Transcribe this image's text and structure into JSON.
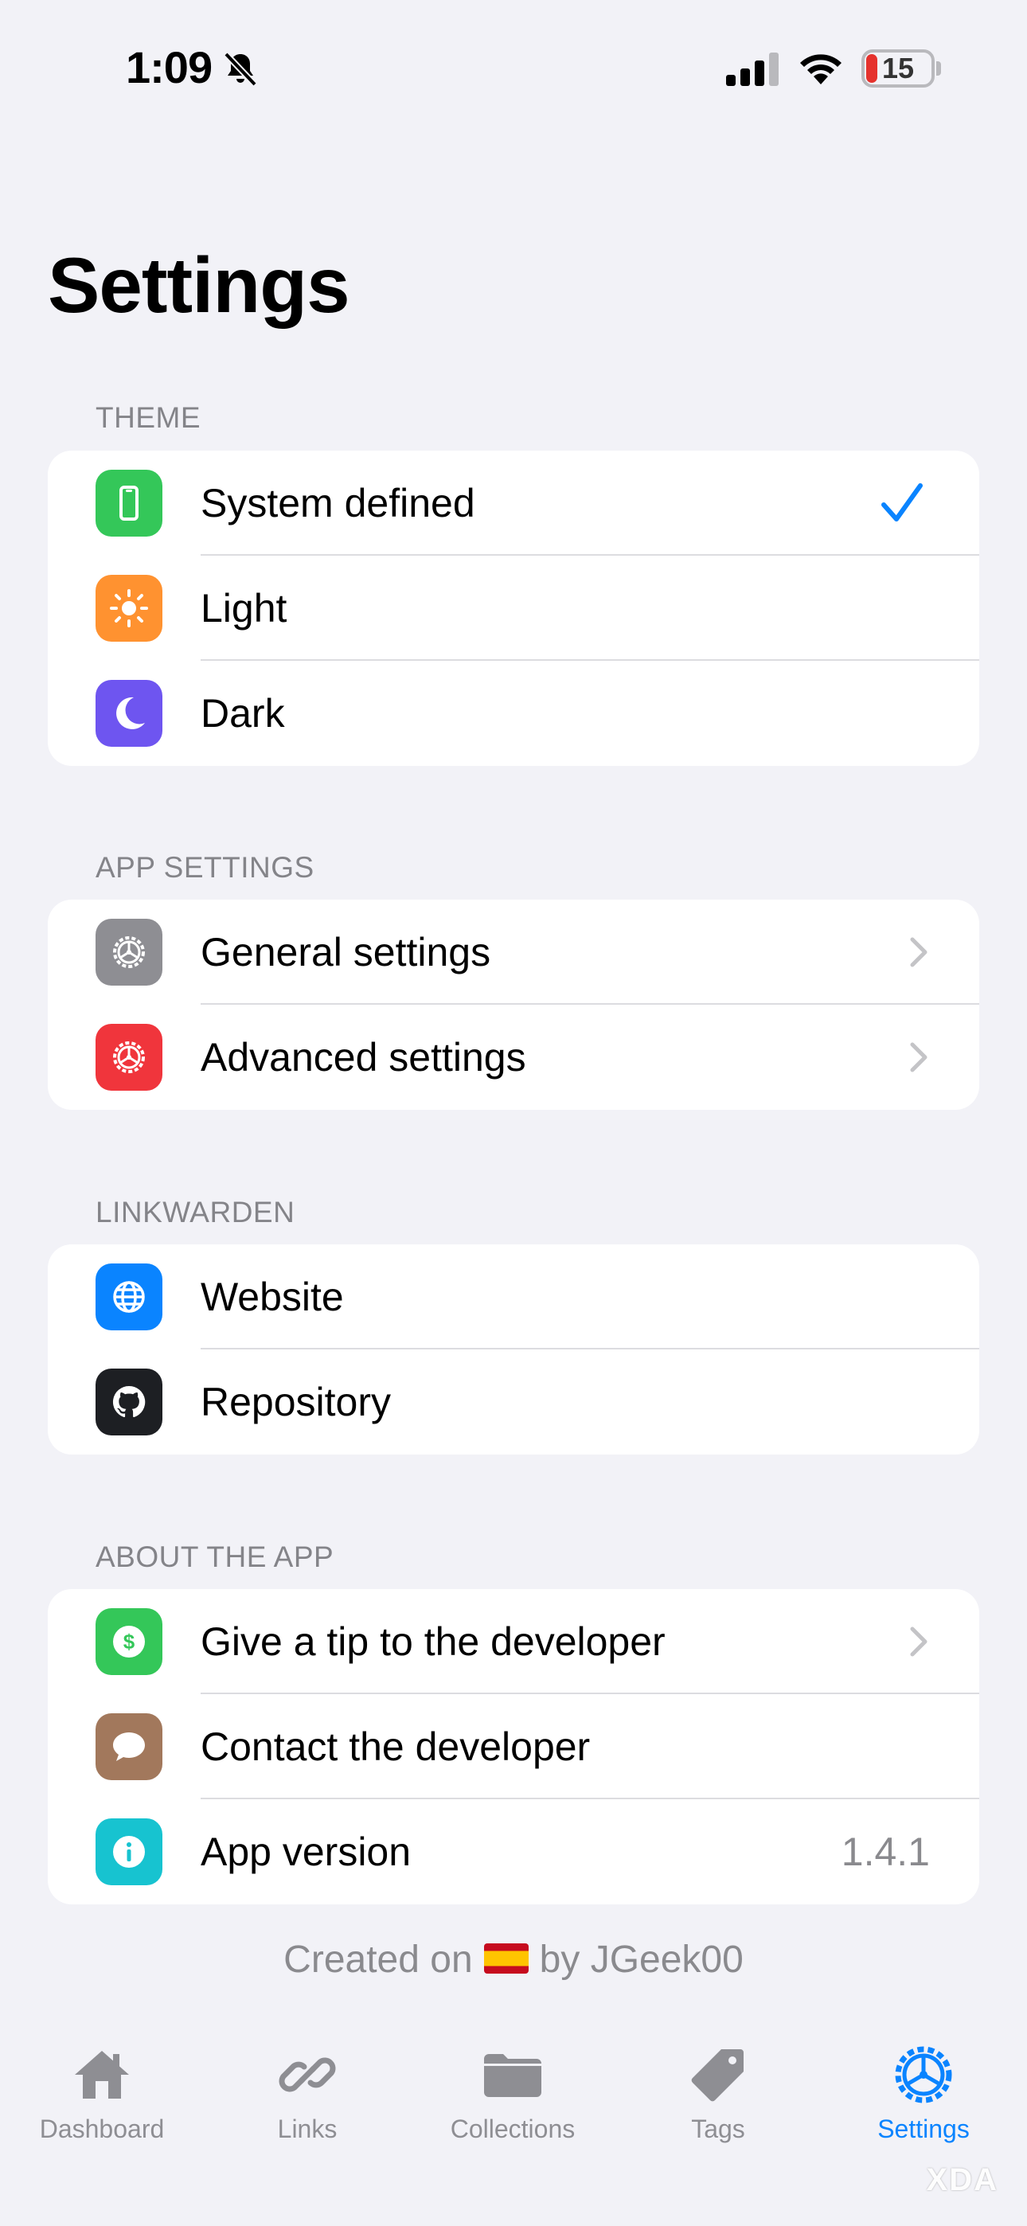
{
  "status_bar": {
    "time": "1:09",
    "battery": "15"
  },
  "title": "Settings",
  "sections": {
    "theme": {
      "header": "THEME",
      "items": [
        {
          "label": "System defined",
          "icon": "phone-icon",
          "color": "#34c759",
          "selected": true
        },
        {
          "label": "Light",
          "icon": "sun-icon",
          "color": "#ff9230"
        },
        {
          "label": "Dark",
          "icon": "moon-icon",
          "color": "#6e55f0"
        }
      ]
    },
    "app_settings": {
      "header": "APP SETTINGS",
      "items": [
        {
          "label": "General settings",
          "icon": "gear-icon",
          "color": "#8e8e93"
        },
        {
          "label": "Advanced settings",
          "icon": "gear-icon",
          "color": "#f0353c"
        }
      ]
    },
    "linkwarden": {
      "header": "LINKWARDEN",
      "items": [
        {
          "label": "Website",
          "icon": "globe-icon",
          "color": "#0a84ff"
        },
        {
          "label": "Repository",
          "icon": "github-icon",
          "color": "#1d1f23"
        }
      ]
    },
    "about": {
      "header": "ABOUT THE APP",
      "items": [
        {
          "label": "Give a tip to the developer",
          "icon": "dollar-icon",
          "color": "#34c759"
        },
        {
          "label": "Contact the developer",
          "icon": "chat-bubble-icon",
          "color": "#a2785c"
        },
        {
          "label": "App version",
          "icon": "info-icon",
          "color": "#17c3d0",
          "value": "1.4.1"
        }
      ]
    }
  },
  "footer": {
    "prefix": "Created on",
    "suffix": "by JGeek00"
  },
  "tabs": [
    {
      "label": "Dashboard",
      "icon": "house-icon"
    },
    {
      "label": "Links",
      "icon": "link-icon"
    },
    {
      "label": "Collections",
      "icon": "folder-icon"
    },
    {
      "label": "Tags",
      "icon": "tag-icon"
    },
    {
      "label": "Settings",
      "icon": "gear-icon",
      "active": true
    }
  ],
  "accent_color": "#0a84ff",
  "watermark": "XDA"
}
